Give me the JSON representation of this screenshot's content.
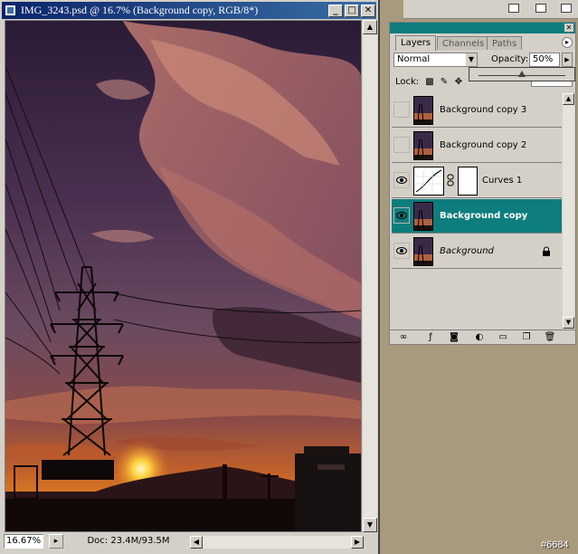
{
  "document_window": {
    "title": "IMG_3243.psd @ 16.7% (Background copy, RGB/8*)",
    "controls": {
      "minimize": "_",
      "maximize": "□",
      "close": "✕"
    },
    "zoom": "16.67%",
    "doc_info": "Doc: 23.4M/93.5M"
  },
  "layers_panel": {
    "tabs": [
      {
        "label": "Layers",
        "active": true
      },
      {
        "label": "Channels",
        "active": false
      },
      {
        "label": "Paths",
        "active": false
      }
    ],
    "blend_mode": "Normal",
    "opacity_label": "Opacity:",
    "opacity_value": "50%",
    "opacity_fraction": 0.5,
    "lock_label": "Lock:",
    "layers": [
      {
        "name": "Background copy 3",
        "visible": false,
        "selected": false
      },
      {
        "name": "Background copy 2",
        "visible": false,
        "selected": false
      },
      {
        "name": "Curves 1",
        "visible": true,
        "selected": false,
        "type": "adjustment"
      },
      {
        "name": "Background copy",
        "visible": true,
        "selected": true
      },
      {
        "name": "Background",
        "visible": true,
        "selected": false,
        "locked": true,
        "italic": true
      }
    ]
  },
  "watermark": "#6684",
  "colors": {
    "titlebar_start": "#0a246a",
    "titlebar_end": "#3a6ea5",
    "palette_accent": "#0e7d7d",
    "chrome": "#d4d0c8",
    "desktop": "#a89a7c"
  }
}
